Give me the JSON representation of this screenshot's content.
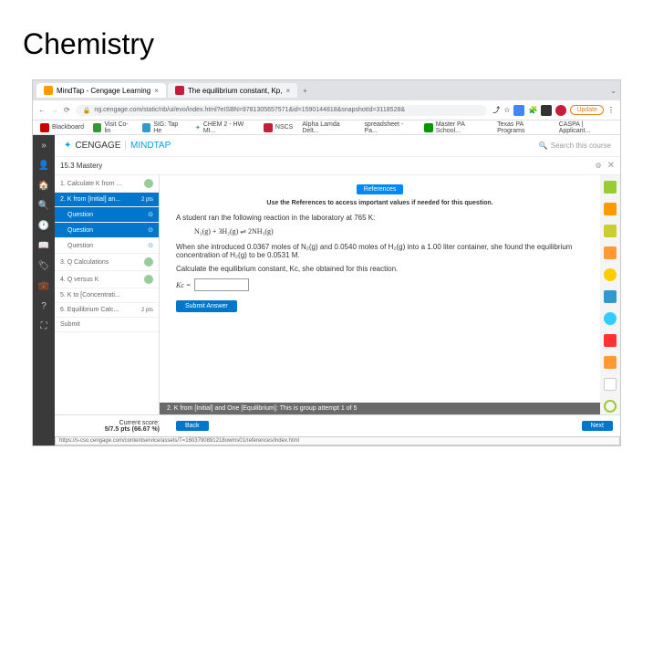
{
  "page": {
    "title": "Chemistry"
  },
  "browser": {
    "tabs": [
      {
        "label": "MindTap - Cengage Learning"
      },
      {
        "label": "The equilibrium constant, Kp,"
      }
    ],
    "url": "ng.cengage.com/static/nb/ui/evo/index.html?eISBN=9781305657571&id=1590144818&snapshotId=3118528&",
    "update": "Update",
    "bookmarks": [
      "Blackboard",
      "Visit Co-lin",
      "SIG: Tap He",
      "CHEM 2 - HW MI...",
      "NSCS",
      "Alpha Lamda Delt...",
      "spreadsheet - Pa...",
      "Master PA School...",
      "Texas PA Programs",
      "CASPA | Applicant..."
    ]
  },
  "app": {
    "brand1": "CENGAGE",
    "brand2": "MINDTAP",
    "search": "Search this course",
    "chapter": "15.3 Mastery",
    "items": [
      {
        "label": "1. Calculate K from ...",
        "pts": ""
      },
      {
        "label": "2. K from [Initial] an...",
        "pts": "2 pts"
      },
      {
        "label": "Question",
        "pts": ""
      },
      {
        "label": "Question",
        "pts": ""
      },
      {
        "label": "Question",
        "pts": ""
      },
      {
        "label": "3. Q Calculations",
        "pts": ""
      },
      {
        "label": "4. Q versus K",
        "pts": ""
      },
      {
        "label": "5. K to [Concentrati...",
        "pts": ""
      },
      {
        "label": "6. Equilibrium Calc...",
        "pts": "2 pts"
      },
      {
        "label": "Submit",
        "pts": ""
      }
    ],
    "references": "References",
    "hint": "Use the References to access important values if needed for this question.",
    "line1": "A student ran the following reaction in the laboratory at 765 K:",
    "equation": "N₂(g) + 3H₂(g) ⇌ 2NH₃(g)",
    "line2": "When she introduced 0.0367 moles of N₂(g) and 0.0540 moles of H₂(g) into a 1.00 liter container, she found the equilibrium concentration of H₂(g) to be 0.0531 M.",
    "line3": "Calculate the equilibrium constant, Kc, she obtained for this reaction.",
    "kc_label": "Kc =",
    "submit_answer": "Submit Answer",
    "status": "2. K from [Initial] and One [Equilibrium]: This is group attempt 1 of 5",
    "score_label": "Current score:",
    "score_value": "5/7.5 pts (66.67 %)",
    "back": "Back",
    "next": "Next",
    "url_status": "https://s-cso.cengage.com/contentservice/assets/T=1603790891218owms01/references/index.html"
  }
}
